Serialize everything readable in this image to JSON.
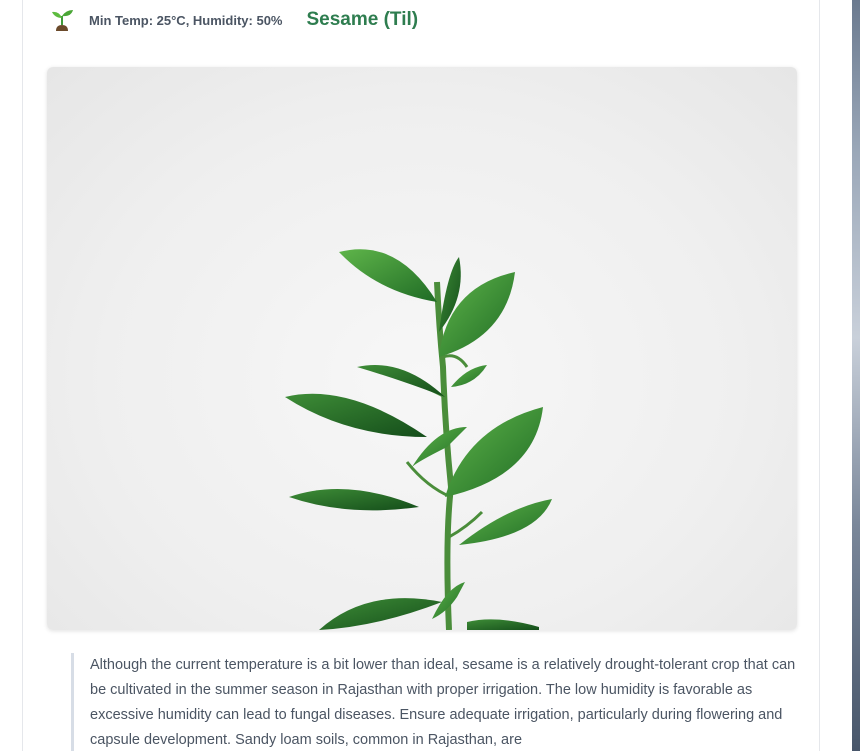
{
  "crop": {
    "icon": "seedling-icon",
    "conditions": "Min Temp: 25°C, Humidity: 50%",
    "name": "Sesame (Til)"
  },
  "image": {
    "subject": "plant-photo"
  },
  "description": "Although the current temperature is a bit lower than ideal, sesame is a relatively drought-tolerant crop that can be cultivated in the summer season in Rajasthan with proper irrigation. The low humidity is favorable as excessive humidity can lead to fungal diseases. Ensure adequate irrigation, particularly during flowering and capsule development. Sandy loam soils, common in Rajasthan, are",
  "colors": {
    "title": "#2e7d4f",
    "text": "#4b5563",
    "quote_border": "#d7dde6"
  }
}
